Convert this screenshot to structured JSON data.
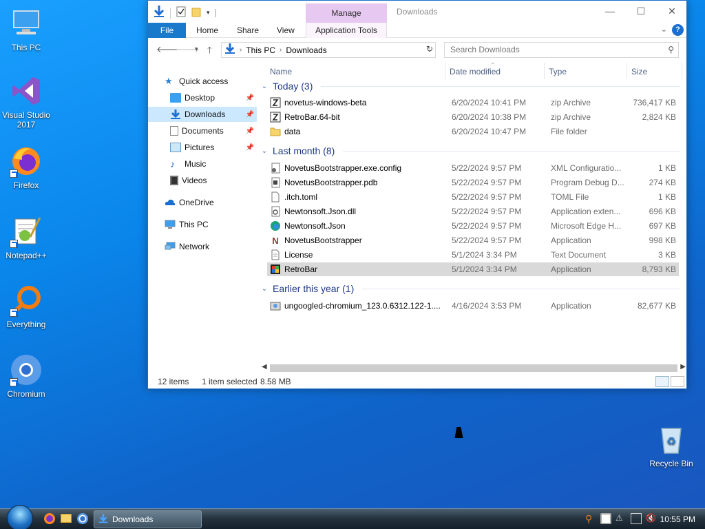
{
  "desktop": {
    "icons": [
      {
        "label": "This PC",
        "icon": "computer-icon"
      },
      {
        "label": "Visual Studio 2017",
        "icon": "visual-studio-icon"
      },
      {
        "label": "Firefox",
        "icon": "firefox-icon"
      },
      {
        "label": "Notepad++",
        "icon": "notepadpp-icon"
      },
      {
        "label": "Everything",
        "icon": "everything-search-icon"
      },
      {
        "label": "Chromium",
        "icon": "chromium-icon"
      },
      {
        "label": "Recycle Bin",
        "icon": "recycle-bin-icon"
      }
    ]
  },
  "window": {
    "title": "Downloads",
    "manage_label": "Manage",
    "ribbon": {
      "file": "File",
      "home": "Home",
      "share": "Share",
      "view": "View",
      "app_tools": "Application Tools"
    },
    "address": {
      "root": "This PC",
      "current": "Downloads"
    },
    "search_placeholder": "Search Downloads",
    "nav": {
      "quick_access": "Quick access",
      "desktop": "Desktop",
      "downloads": "Downloads",
      "documents": "Documents",
      "pictures": "Pictures",
      "music": "Music",
      "videos": "Videos",
      "onedrive": "OneDrive",
      "this_pc": "This PC",
      "network": "Network"
    },
    "columns": {
      "name": "Name",
      "date": "Date modified",
      "type": "Type",
      "size": "Size"
    },
    "groups": [
      {
        "label": "Today (3)",
        "rows": [
          {
            "name": "novetus-windows-beta",
            "date": "6/20/2024 10:41 PM",
            "type": "zip Archive",
            "size": "736,417 KB",
            "icon": "zip-icon"
          },
          {
            "name": "RetroBar.64-bit",
            "date": "6/20/2024 10:38 PM",
            "type": "zip Archive",
            "size": "2,824 KB",
            "icon": "zip-icon"
          },
          {
            "name": "data",
            "date": "6/20/2024 10:47 PM",
            "type": "File folder",
            "size": "",
            "icon": "folder-icon"
          }
        ]
      },
      {
        "label": "Last month (8)",
        "rows": [
          {
            "name": "NovetusBootstrapper.exe.config",
            "date": "5/22/2024 9:57 PM",
            "type": "XML Configuratio...",
            "size": "1 KB",
            "icon": "config-file-icon"
          },
          {
            "name": "NovetusBootstrapper.pdb",
            "date": "5/22/2024 9:57 PM",
            "type": "Program Debug D...",
            "size": "274 KB",
            "icon": "debug-file-icon"
          },
          {
            "name": ".itch.toml",
            "date": "5/22/2024 9:57 PM",
            "type": "TOML File",
            "size": "1 KB",
            "icon": "blank-file-icon"
          },
          {
            "name": "Newtonsoft.Json.dll",
            "date": "5/22/2024 9:57 PM",
            "type": "Application exten...",
            "size": "696 KB",
            "icon": "dll-file-icon"
          },
          {
            "name": "Newtonsoft.Json",
            "date": "5/22/2024 9:57 PM",
            "type": "Microsoft Edge H...",
            "size": "697 KB",
            "icon": "edge-icon"
          },
          {
            "name": "NovetusBootstrapper",
            "date": "5/22/2024 9:57 PM",
            "type": "Application",
            "size": "998 KB",
            "icon": "novetus-icon"
          },
          {
            "name": "License",
            "date": "5/1/2024 3:34 PM",
            "type": "Text Document",
            "size": "3 KB",
            "icon": "text-file-icon"
          },
          {
            "name": "RetroBar",
            "date": "5/1/2024 3:34 PM",
            "type": "Application",
            "size": "8,793 KB",
            "icon": "retrobar-icon",
            "selected": true
          }
        ]
      },
      {
        "label": "Earlier this year (1)",
        "rows": [
          {
            "name": "ungoogled-chromium_123.0.6312.122-1....",
            "date": "4/16/2024 3:53 PM",
            "type": "Application",
            "size": "82,677 KB",
            "icon": "installer-icon"
          }
        ]
      }
    ],
    "status": {
      "count": "12 items",
      "selected": "1 item selected",
      "size": "8.58 MB"
    }
  },
  "taskbar": {
    "active_window": "Downloads",
    "clock": "10:55 PM"
  }
}
